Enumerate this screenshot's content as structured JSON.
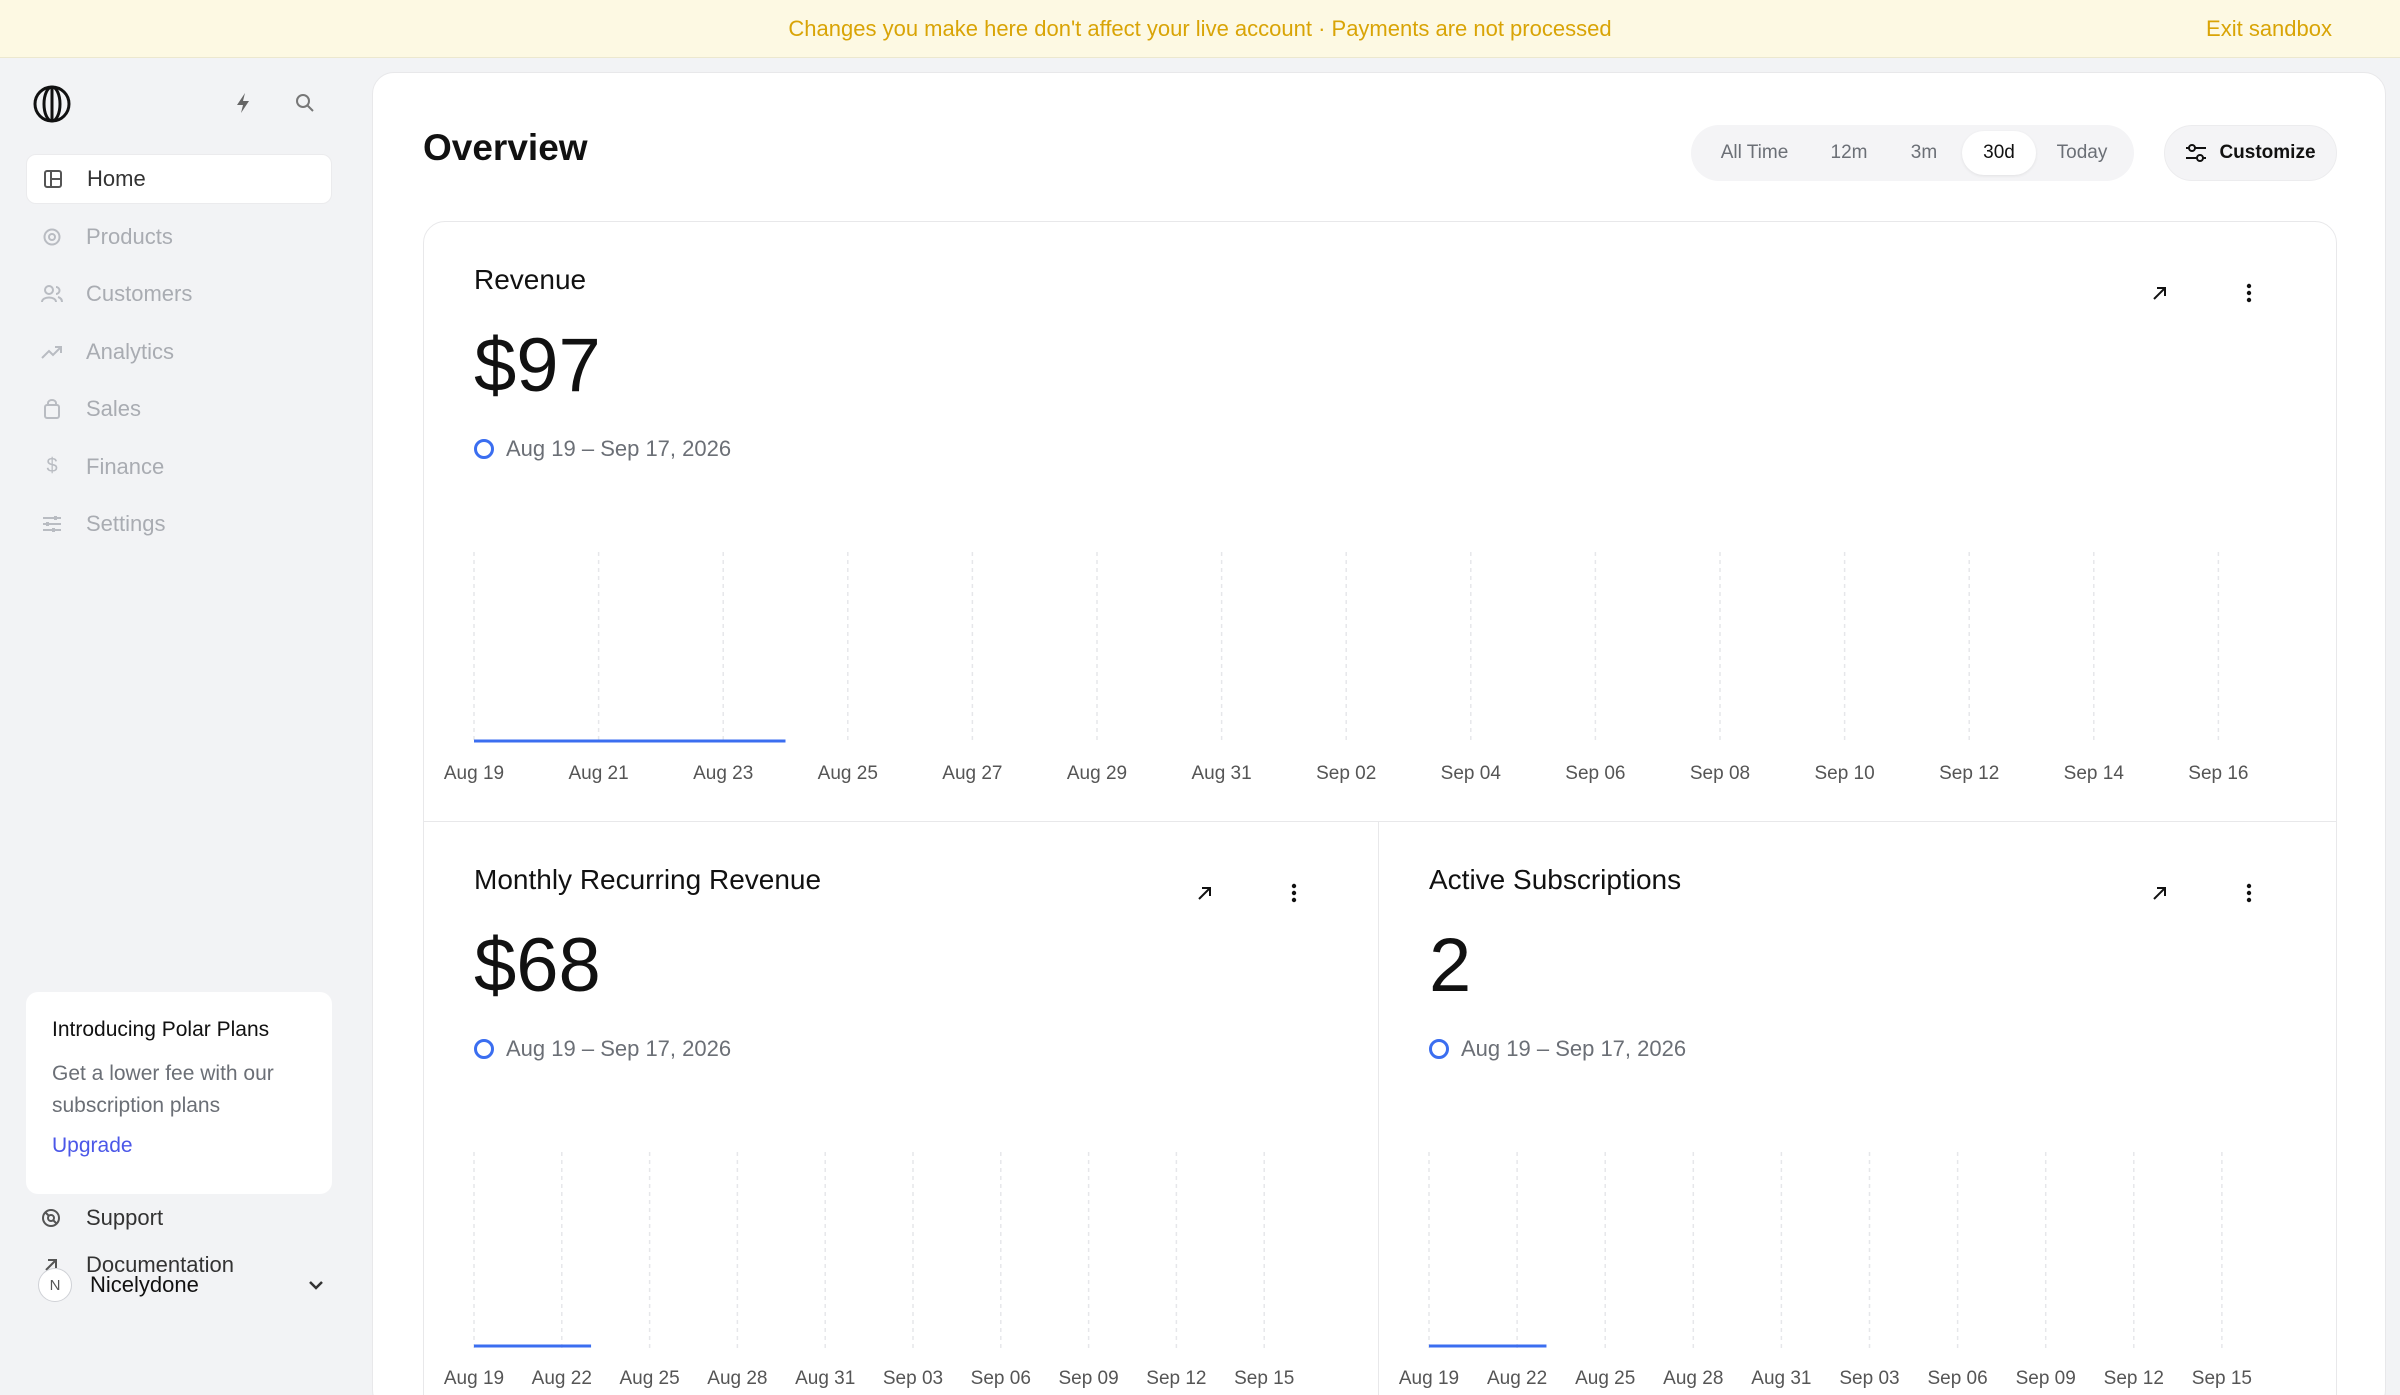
{
  "banner": {
    "message": "Changes you make here don't affect your live account · Payments are not processed",
    "exit_label": "Exit sandbox"
  },
  "sidebar": {
    "items": [
      {
        "label": "Home",
        "icon": "home-icon",
        "active": true
      },
      {
        "label": "Products",
        "icon": "products-icon",
        "active": false
      },
      {
        "label": "Customers",
        "icon": "customers-icon",
        "active": false
      },
      {
        "label": "Analytics",
        "icon": "analytics-icon",
        "active": false
      },
      {
        "label": "Sales",
        "icon": "sales-icon",
        "active": false
      },
      {
        "label": "Finance",
        "icon": "finance-icon",
        "active": false
      },
      {
        "label": "Settings",
        "icon": "settings-icon",
        "active": false
      }
    ],
    "promo": {
      "title": "Introducing Polar Plans",
      "text": "Get a lower fee with our subscription plans",
      "link": "Upgrade"
    },
    "support_label": "Support",
    "docs_label": "Documentation",
    "user": {
      "initial": "N",
      "name": "Nicelydone"
    }
  },
  "main": {
    "title": "Overview",
    "ranges": [
      "All Time",
      "12m",
      "3m",
      "30d",
      "Today"
    ],
    "selected_range": "30d",
    "customize_label": "Customize"
  },
  "cards": {
    "revenue": {
      "title": "Revenue",
      "value": "$97",
      "range": "Aug 19 – Sep 17, 2026"
    },
    "mrr": {
      "title": "Monthly Recurring Revenue",
      "value": "$68",
      "range": "Aug 19 – Sep 17, 2026"
    },
    "subs": {
      "title": "Active Subscriptions",
      "value": "2",
      "range": "Aug 19 – Sep 17, 2026"
    }
  },
  "colors": {
    "accent": "#3b6ef0",
    "banner_text": "#d9a406",
    "link": "#4b57e8"
  },
  "chart_data": [
    {
      "type": "line",
      "title": "Revenue",
      "x": [
        "Aug 19",
        "Aug 21",
        "Aug 23",
        "Aug 25",
        "Aug 27",
        "Aug 29",
        "Aug 31",
        "Sep 02",
        "Sep 04",
        "Sep 06",
        "Sep 08",
        "Sep 10",
        "Sep 12",
        "Sep 14",
        "Sep 16"
      ],
      "series": [
        {
          "x_start": "Aug 19",
          "x_end": "Aug 24",
          "values": [
            0,
            0
          ]
        }
      ],
      "grid": true
    },
    {
      "type": "line",
      "title": "Monthly Recurring Revenue",
      "x": [
        "Aug 19",
        "Aug 22",
        "Aug 25",
        "Aug 28",
        "Aug 31",
        "Sep 03",
        "Sep 06",
        "Sep 09",
        "Sep 12",
        "Sep 15"
      ],
      "series": [
        {
          "x_start": "Aug 19",
          "x_end": "Aug 23",
          "values": [
            0,
            0
          ]
        }
      ],
      "grid": true
    },
    {
      "type": "line",
      "title": "Active Subscriptions",
      "x": [
        "Aug 19",
        "Aug 22",
        "Aug 25",
        "Aug 28",
        "Aug 31",
        "Sep 03",
        "Sep 06",
        "Sep 09",
        "Sep 12",
        "Sep 15"
      ],
      "series": [
        {
          "x_start": "Aug 19",
          "x_end": "Aug 23",
          "values": [
            0,
            0
          ]
        }
      ],
      "grid": true
    }
  ]
}
